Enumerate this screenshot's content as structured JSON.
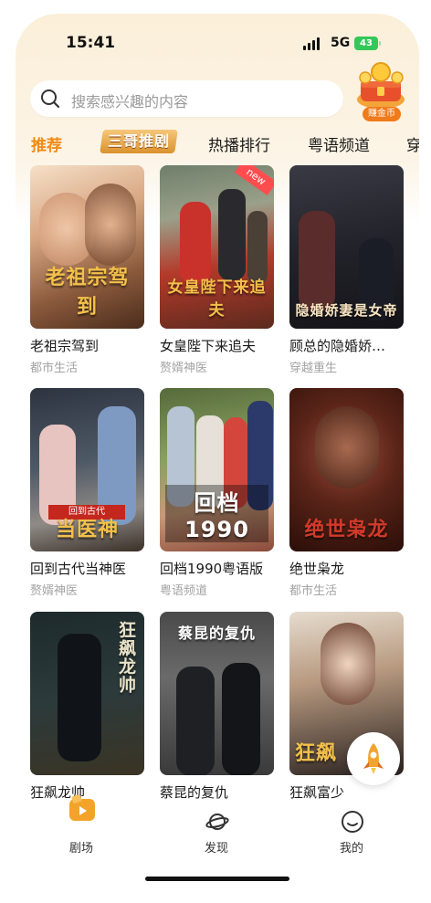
{
  "status_bar": {
    "time": "15:41",
    "network": "5G",
    "battery": "43"
  },
  "search": {
    "placeholder": "搜索感兴趣的内容",
    "icon": "search-icon"
  },
  "reward": {
    "label": "赚金币",
    "icon": "gold-coin-treasure-icon"
  },
  "tabs": [
    {
      "label": "推荐",
      "active": true
    },
    {
      "label": "三哥推剧",
      "special": true
    },
    {
      "label": "热播排行"
    },
    {
      "label": "粤语频道"
    },
    {
      "label": "穿"
    }
  ],
  "dramas": [
    {
      "title": "老祖宗驾到",
      "tag": "都市生活",
      "poster_text": "老祖宗驾到"
    },
    {
      "title": "女皇陛下来追夫",
      "tag": "赘婿神医",
      "poster_text": "女皇陛下来追夫",
      "badge": "new"
    },
    {
      "title": "顾总的隐婚娇…",
      "tag": "穿越重生",
      "poster_text": "隐婚娇妻是女帝"
    },
    {
      "title": "回到古代当神医",
      "tag": "赘婿神医",
      "poster_text": "当医神",
      "poster_ribbon": "回到古代"
    },
    {
      "title": "回档1990粤语版",
      "tag": "粤语频道",
      "poster_text": "回档1990"
    },
    {
      "title": "绝世枭龙",
      "tag": "都市生活",
      "poster_text": "绝世枭龙"
    },
    {
      "title": "狂飙龙帅",
      "tag": "",
      "poster_text": "狂飙龙帅"
    },
    {
      "title": "蔡昆的复仇",
      "tag": "",
      "poster_text": "蔡昆的复仇"
    },
    {
      "title": "狂飙富少",
      "tag": "",
      "poster_text": "狂飙"
    }
  ],
  "bottom_nav": [
    {
      "label": "剧场",
      "icon": "theater-icon",
      "active": true
    },
    {
      "label": "发现",
      "icon": "planet-icon"
    },
    {
      "label": "我的",
      "icon": "profile-icon"
    }
  ],
  "colors": {
    "accent": "#f28a16",
    "tag_gray": "#a3a3a3"
  }
}
